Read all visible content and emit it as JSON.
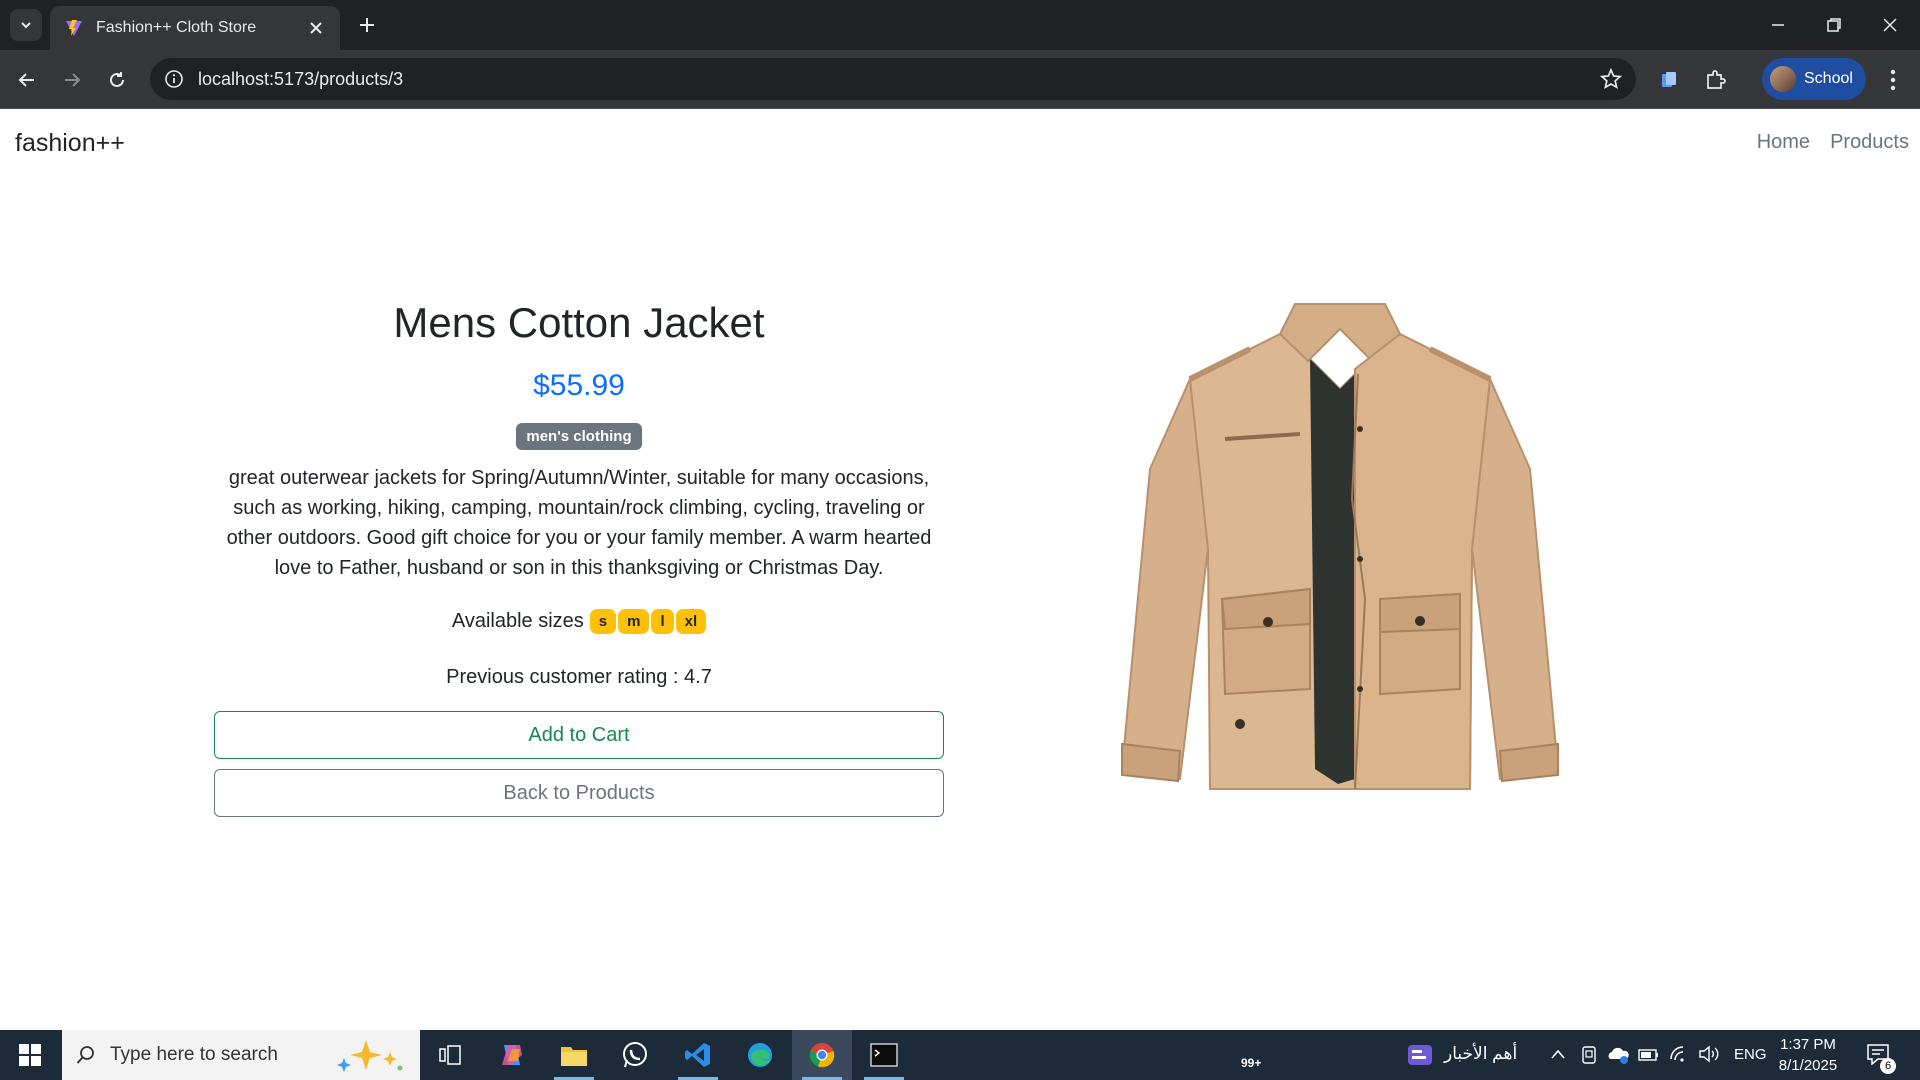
{
  "browser": {
    "tab_title": "Fashion++ Cloth Store",
    "url": "localhost:5173/products/3",
    "profile_label": "School"
  },
  "site": {
    "brand": "fashion++",
    "nav": [
      "Home",
      "Products"
    ]
  },
  "product": {
    "title": "Mens Cotton Jacket",
    "price": "$55.99",
    "category": "men's clothing",
    "description": "great outerwear jackets for Spring/Autumn/Winter, suitable for many occasions, such as working, hiking, camping, mountain/rock climbing, cycling, traveling or other outdoors. Good gift choice for you or your family member. A warm hearted love to Father, husband or son in this thanksgiving or Christmas Day.",
    "sizes_label": "Available sizes",
    "sizes": [
      "s",
      "m",
      "l",
      "xl"
    ],
    "rating_text": "Previous customer rating : 4.7",
    "add_to_cart": "Add to Cart",
    "back_to_products": "Back to Products"
  },
  "taskbar": {
    "search_placeholder": "Type here to search",
    "whatsapp_badge": "99+",
    "news_label": "أهم الأخبار",
    "language": "ENG",
    "time": "1:37 PM",
    "date": "8/1/2025",
    "notification_count": "6"
  },
  "colors": {
    "price": "#0d6efd",
    "category_badge": "#6c757d",
    "size_badge": "#ffc107",
    "add_to_cart": "#198754",
    "back_button": "#6c757d"
  }
}
